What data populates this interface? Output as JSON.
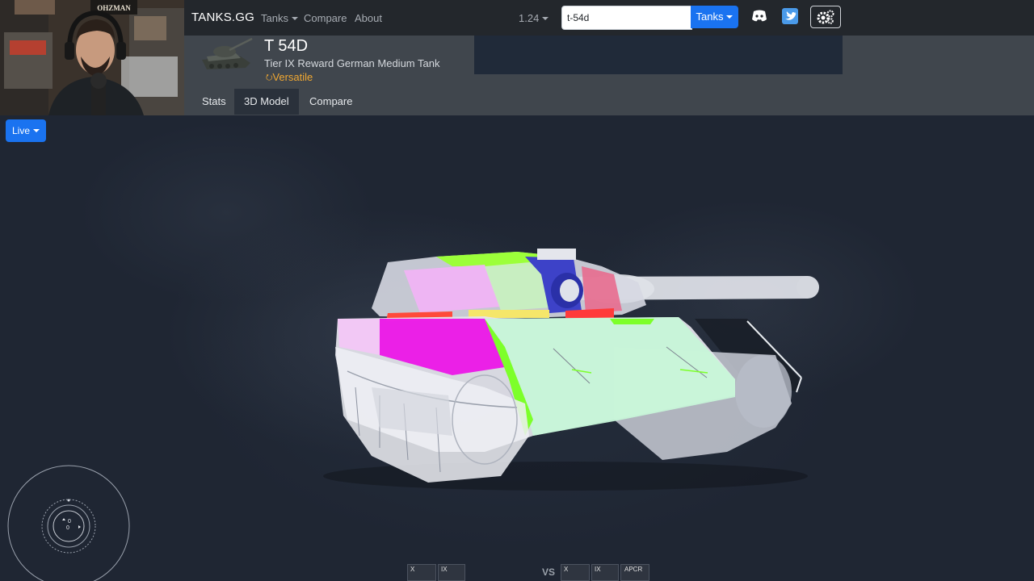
{
  "navbar": {
    "brand": "TANKS.GG",
    "links": [
      {
        "label": "Tanks",
        "dropdown": true
      },
      {
        "label": "Compare",
        "dropdown": false
      },
      {
        "label": "About",
        "dropdown": false
      }
    ],
    "version": "1.24",
    "search": {
      "value": "t-54d",
      "category": "Tanks"
    },
    "icons": [
      "discord-icon",
      "twitter-icon",
      "settings-icon"
    ]
  },
  "webcam": {
    "sign_text": "OHZMAN"
  },
  "tank": {
    "name": "T 54D",
    "description": "Tier IX Reward German Medium Tank",
    "role": "Versatile"
  },
  "tabs": [
    {
      "label": "Stats",
      "active": false
    },
    {
      "label": "3D Model",
      "active": true
    },
    {
      "label": "Compare",
      "active": false
    }
  ],
  "viewer": {
    "mode_button": "Live",
    "compass": {
      "top": "0",
      "bottom": "0"
    }
  },
  "comparison_bar": {
    "left": [
      {
        "tier": "X"
      },
      {
        "tier": "IX"
      }
    ],
    "vs": "VS",
    "right": [
      {
        "tier": "X"
      },
      {
        "tier": "IX"
      },
      {
        "tier": "APCR"
      }
    ]
  },
  "colors": {
    "accent": "#1a73f0",
    "role": "#f0a832",
    "navbar": "#23272c",
    "header": "#40464d"
  }
}
